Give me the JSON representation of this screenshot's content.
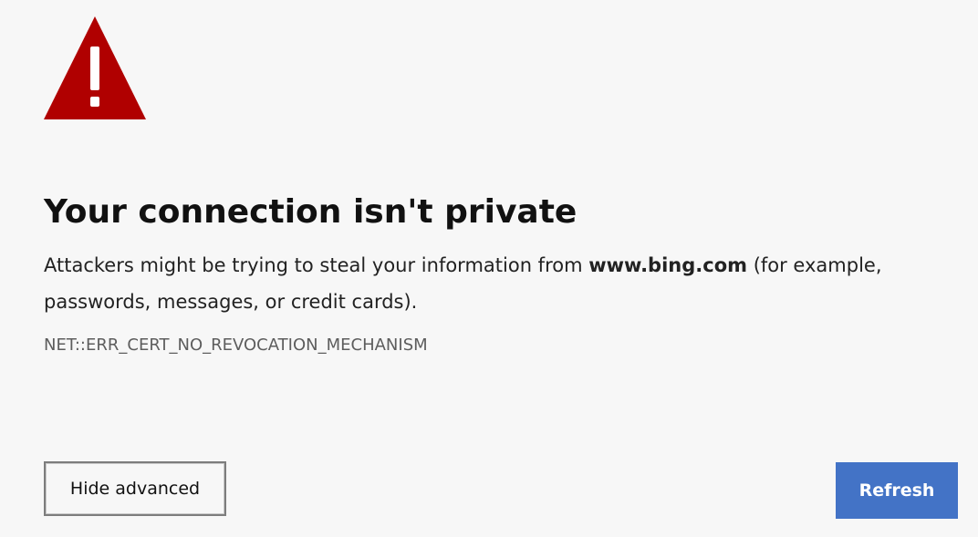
{
  "icons": {
    "warning": "warning-triangle-icon"
  },
  "colors": {
    "background": "#f7f7f7",
    "warning": "#b00000",
    "primary_button": "#4373c6",
    "error_code_text": "#5d5d5d"
  },
  "error": {
    "title": "Your connection isn't private",
    "description_before": "Attackers might be trying to steal your information from ",
    "site": "www.bing.com",
    "description_after": " (for example, passwords, messages, or credit cards).",
    "code": "NET::ERR_CERT_NO_REVOCATION_MECHANISM"
  },
  "actions": {
    "hide_advanced_label": "Hide advanced",
    "refresh_label": "Refresh"
  }
}
